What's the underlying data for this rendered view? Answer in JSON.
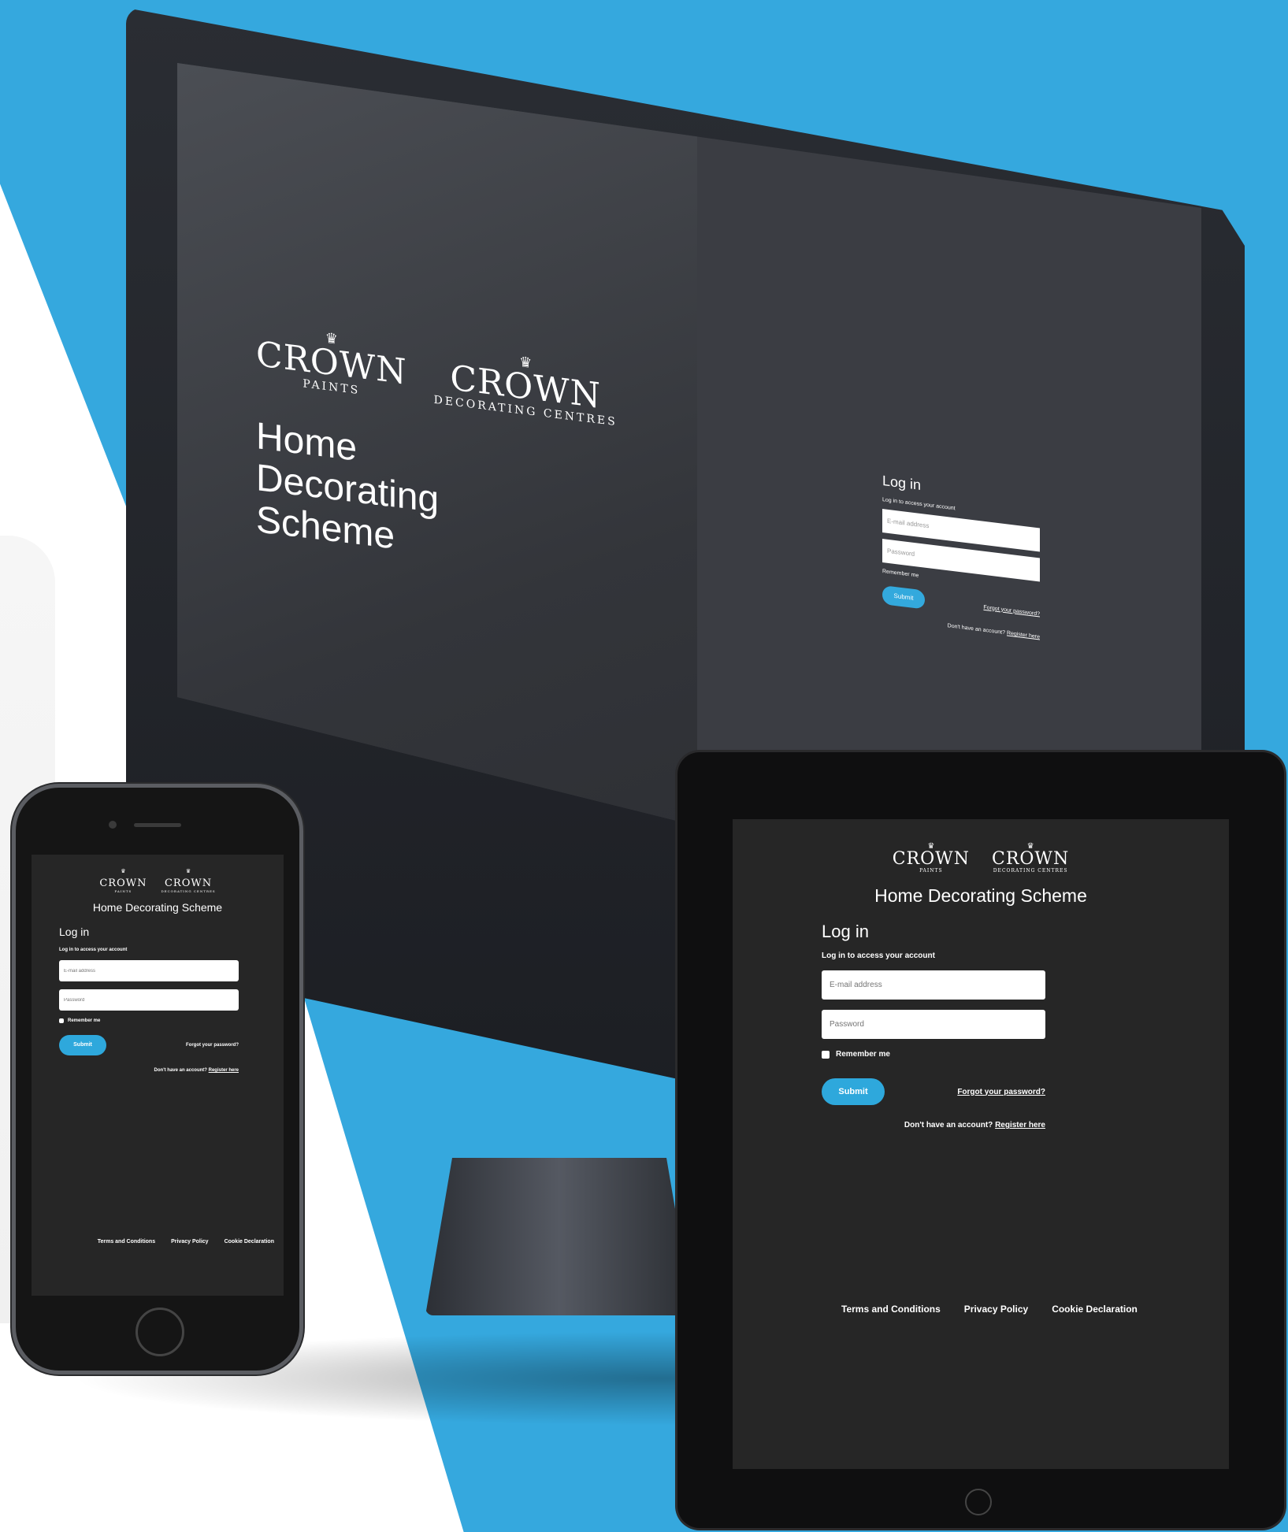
{
  "colors": {
    "background_blue": "#35a8de",
    "accent": "#2ea8dc",
    "screen_bg": "#262626"
  },
  "logos": {
    "paints": {
      "name": "CROWN",
      "sub": "PAINTS",
      "icon": "crown-icon"
    },
    "centres": {
      "name": "CROWN",
      "sub": "DECORATING CENTRES",
      "icon": "crown-icon"
    }
  },
  "desktop": {
    "title": "Home Decorating Scheme",
    "login": {
      "heading": "Log in",
      "subheading": "Log in to access your account",
      "email_placeholder": "E-mail address",
      "password_placeholder": "Password",
      "remember": "Remember me",
      "submit": "Submit",
      "forgot": "Forgot your password?",
      "register_prompt": "Don't have an account?",
      "register_link": "Register here"
    }
  },
  "tablet": {
    "title": "Home Decorating Scheme",
    "login": {
      "heading": "Log in",
      "subheading": "Log in to access your account",
      "email_placeholder": "E-mail address",
      "password_placeholder": "Password",
      "remember": "Remember me",
      "submit": "Submit",
      "forgot": "Forgot your password?",
      "register_prompt": "Don't have an account?",
      "register_link": "Register here"
    },
    "footer": [
      "Terms and Conditions",
      "Privacy Policy",
      "Cookie Declaration"
    ]
  },
  "phone": {
    "title": "Home Decorating Scheme",
    "login": {
      "heading": "Log in",
      "subheading": "Log in to access your account",
      "email_placeholder": "E-mail address",
      "password_placeholder": "Password",
      "remember": "Remember me",
      "submit": "Submit",
      "forgot": "Forgot your password?",
      "register_prompt": "Don't have an account?",
      "register_link": "Register here"
    },
    "footer": [
      "Terms and Conditions",
      "Privacy Policy",
      "Cookie Declaration"
    ]
  }
}
